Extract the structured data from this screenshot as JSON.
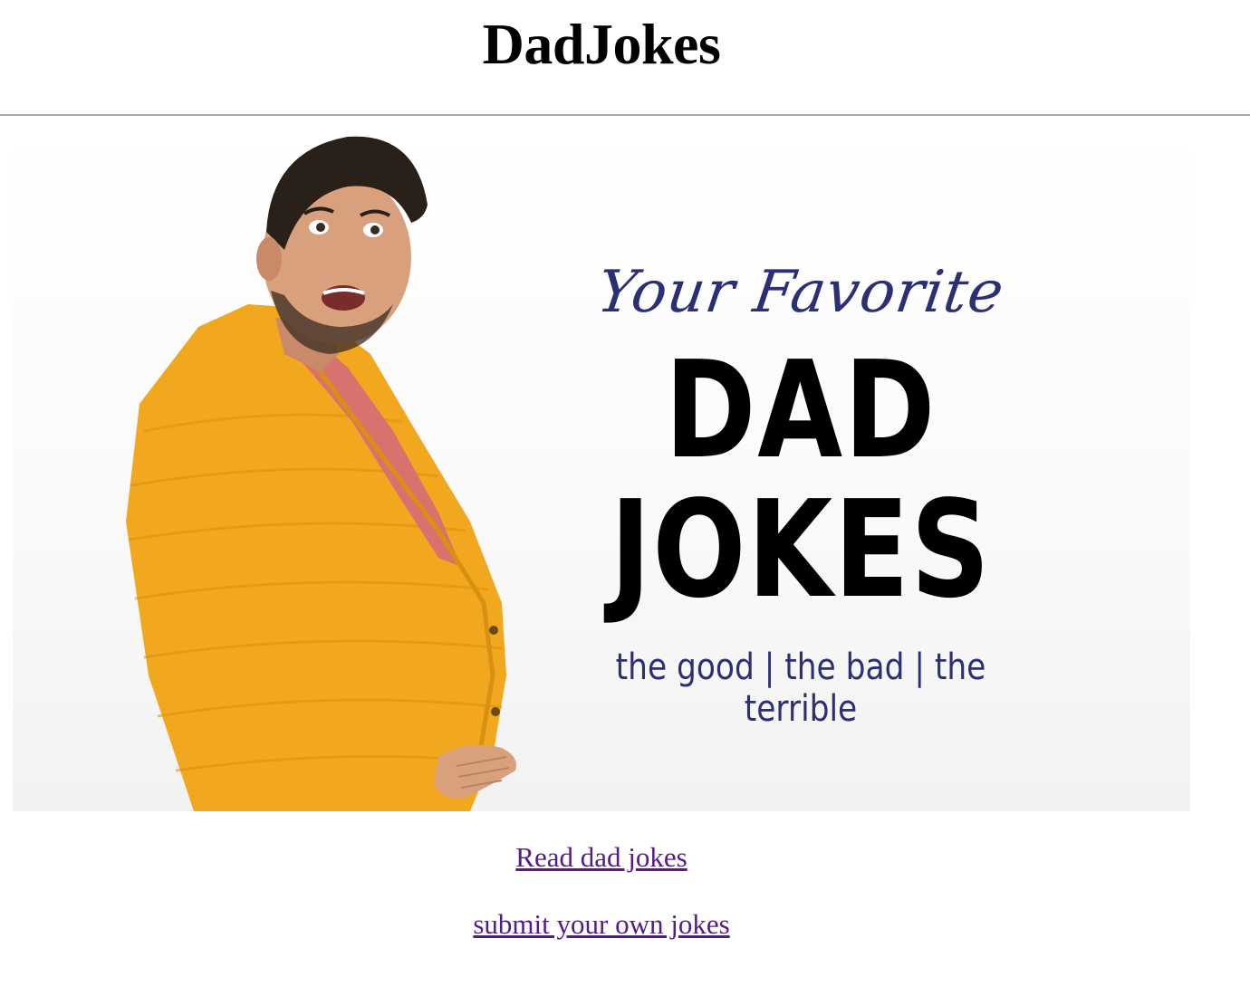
{
  "header": {
    "site_title": "DadJokes"
  },
  "hero": {
    "script_line": "Your Favorite",
    "headline_line1": "DAD",
    "headline_line2": "JOKES",
    "tagline": "the good | the bad | the terrible",
    "colors": {
      "script": "#2b2f74",
      "headline": "#000000",
      "cardigan": "#f2a81e",
      "shirt": "#d9726e"
    }
  },
  "links": {
    "read": "Read dad jokes",
    "submit": "submit your own jokes",
    "visited_color": "#551a8b"
  }
}
